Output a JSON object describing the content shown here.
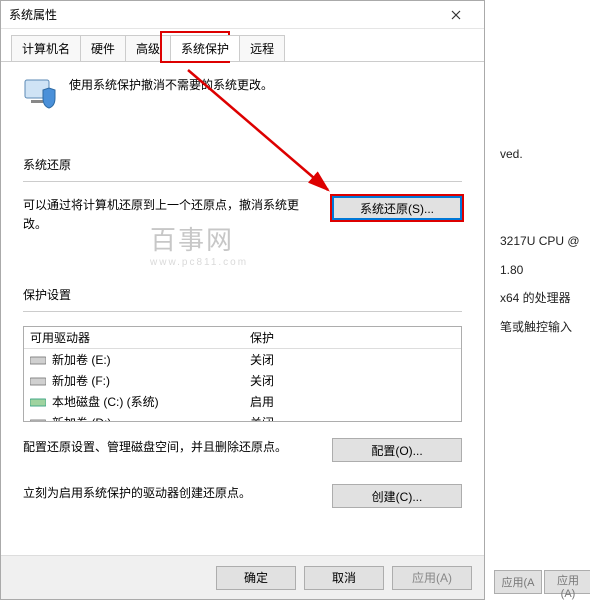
{
  "window": {
    "title": "系统属性"
  },
  "tabs": {
    "items": [
      {
        "label": "计算机名"
      },
      {
        "label": "硬件"
      },
      {
        "label": "高级"
      },
      {
        "label": "系统保护"
      },
      {
        "label": "远程"
      }
    ],
    "active_index": 3
  },
  "intro": {
    "text": "使用系统保护撤消不需要的系统更改。"
  },
  "restore": {
    "group_label": "系统还原",
    "desc": "可以通过将计算机还原到上一个还原点，撤消系统更改。",
    "button": "系统还原(S)..."
  },
  "protection": {
    "group_label": "保护设置",
    "header_drive": "可用驱动器",
    "header_status": "保护",
    "rows": [
      {
        "name": "新加卷 (E:)",
        "status": "关闭"
      },
      {
        "name": "新加卷 (F:)",
        "status": "关闭"
      },
      {
        "name": "本地磁盘 (C:) (系统)",
        "status": "启用"
      },
      {
        "name": "新加卷 (D:)",
        "status": "关闭"
      }
    ],
    "configure_desc": "配置还原设置、管理磁盘空间，并且删除还原点。",
    "configure_btn": "配置(O)...",
    "create_desc": "立刻为启用系统保护的驱动器创建还原点。",
    "create_btn": "创建(C)..."
  },
  "dialog_buttons": {
    "ok": "确定",
    "cancel": "取消",
    "apply": "应用(A)"
  },
  "background": {
    "line1": "ved.",
    "line2": "3217U CPU @ 1.80",
    "line3": "x64 的处理器",
    "line4": "笔或触控输入",
    "apply_btn": "应用(A"
  },
  "watermark": {
    "cn": "百事网",
    "en": "www.pc811.com"
  }
}
